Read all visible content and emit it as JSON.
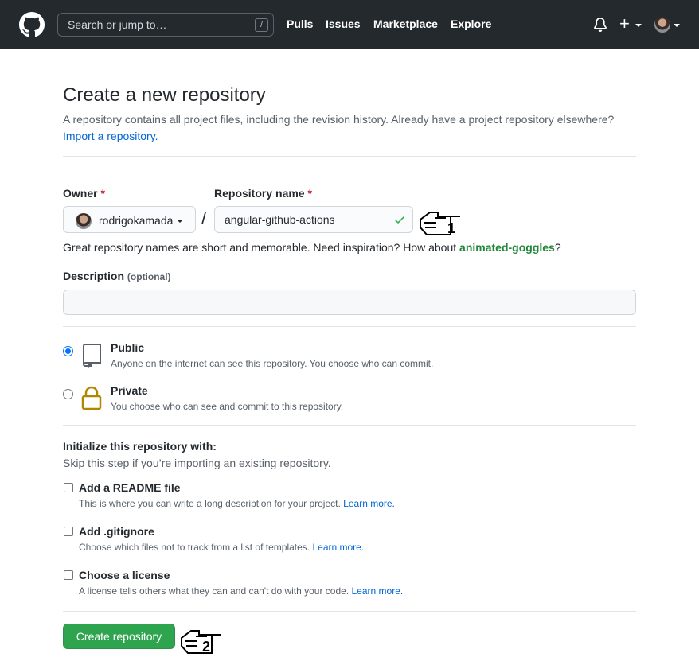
{
  "header": {
    "search_placeholder": "Search or jump to…",
    "search_shortcut": "/",
    "nav": [
      "Pulls",
      "Issues",
      "Marketplace",
      "Explore"
    ]
  },
  "page": {
    "title": "Create a new repository",
    "intro": "A repository contains all project files, including the revision history. Already have a project repository elsewhere?",
    "import_link": "Import a repository."
  },
  "form": {
    "owner_label": "Owner",
    "required_mark": "*",
    "owner_value": "rodrigokamada",
    "separator": "/",
    "repo_label": "Repository name",
    "repo_value": "angular-github-actions",
    "hint_prefix": "Great repository names are short and memorable. Need inspiration? How about ",
    "hint_suggestion": "animated-goggles",
    "hint_suffix": "?",
    "description_label": "Description",
    "description_optional": "(optional)",
    "description_value": ""
  },
  "visibility": {
    "selected": "public",
    "public_title": "Public",
    "public_desc": "Anyone on the internet can see this repository. You choose who can commit.",
    "private_title": "Private",
    "private_desc": "You choose who can see and commit to this repository."
  },
  "init": {
    "title": "Initialize this repository with:",
    "subtitle": "Skip this step if you’re importing an existing repository.",
    "learn_more": "Learn more.",
    "options": [
      {
        "title": "Add a README file",
        "desc": "This is where you can write a long description for your project.",
        "checked": false
      },
      {
        "title": "Add .gitignore",
        "desc": "Choose which files not to track from a list of templates.",
        "checked": false
      },
      {
        "title": "Choose a license",
        "desc": "A license tells others what they can and can't do with your code.",
        "checked": false
      }
    ]
  },
  "submit_label": "Create repository",
  "annotations": [
    "1",
    "2"
  ],
  "colors": {
    "header_bg": "#24292e",
    "link": "#0366d6",
    "success": "#2ea44f",
    "suggestion": "#22863a",
    "required": "#cb2431",
    "private_icon": "#b08800"
  },
  "icons": [
    "github-logo-icon",
    "bell-icon",
    "plus-icon",
    "check-icon",
    "repo-icon",
    "lock-icon",
    "pointing-hand-icon"
  ]
}
